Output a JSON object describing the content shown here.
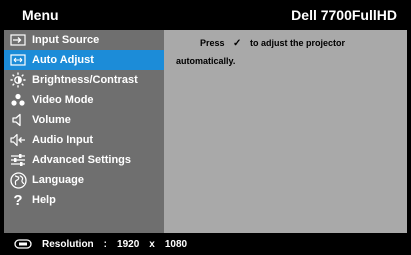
{
  "header": {
    "title": "Menu",
    "model": "Dell 7700FullHD"
  },
  "sidebar": {
    "items": [
      {
        "label": "Input Source",
        "icon": "input-source-icon",
        "selected": false
      },
      {
        "label": "Auto Adjust",
        "icon": "auto-adjust-icon",
        "selected": true
      },
      {
        "label": "Brightness/Contrast",
        "icon": "brightness-icon",
        "selected": false
      },
      {
        "label": "Video Mode",
        "icon": "video-mode-icon",
        "selected": false
      },
      {
        "label": "Volume",
        "icon": "volume-icon",
        "selected": false
      },
      {
        "label": "Audio Input",
        "icon": "audio-input-icon",
        "selected": false
      },
      {
        "label": "Advanced Settings",
        "icon": "advanced-settings-icon",
        "selected": false
      },
      {
        "label": "Language",
        "icon": "language-icon",
        "selected": false
      },
      {
        "label": "Help",
        "icon": "help-icon",
        "selected": false
      }
    ]
  },
  "content": {
    "press": "Press",
    "check": "✓",
    "rest": "to adjust the projector",
    "line2": "automatically."
  },
  "status": {
    "label": "Resolution",
    "sep": ":",
    "width": "1920",
    "x": "x",
    "height": "1080"
  },
  "colors": {
    "selected": "#1c8cd8",
    "sidebar": "#6f6f6f",
    "content": "#a9a9a9",
    "background": "#000000"
  }
}
